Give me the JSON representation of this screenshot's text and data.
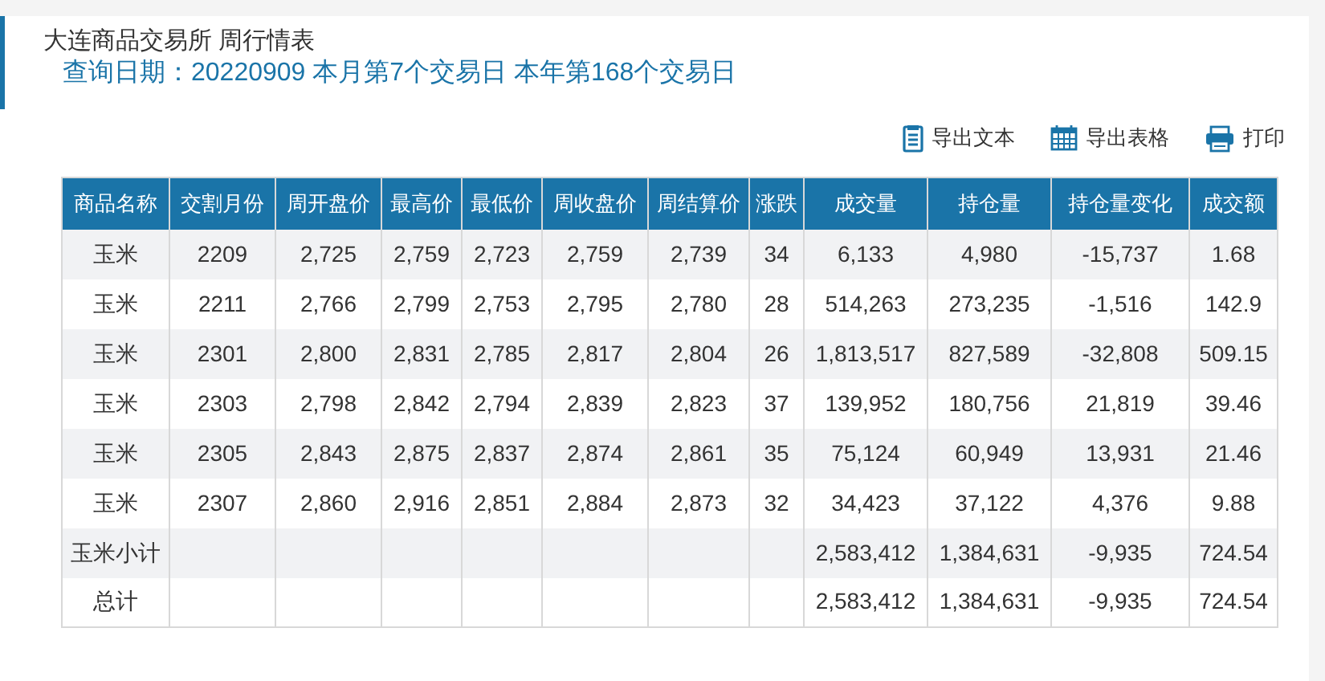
{
  "header": {
    "title": "大连商品交易所 周行情表",
    "query_line": "查询日期：20220909 本月第7个交易日 本年第168个交易日"
  },
  "toolbar": [
    {
      "kind": "text",
      "label": "导出文本"
    },
    {
      "kind": "sheet",
      "label": "导出表格"
    },
    {
      "kind": "print",
      "label": "打印"
    }
  ],
  "table": {
    "columns": [
      "商品名称",
      "交割月份",
      "周开盘价",
      "最高价",
      "最低价",
      "周收盘价",
      "周结算价",
      "涨跌",
      "成交量",
      "持仓量",
      "持仓量变化",
      "成交额"
    ],
    "rows": [
      [
        "玉米",
        "2209",
        "2,725",
        "2,759",
        "2,723",
        "2,759",
        "2,739",
        "34",
        "6,133",
        "4,980",
        "-15,737",
        "1.68"
      ],
      [
        "玉米",
        "2211",
        "2,766",
        "2,799",
        "2,753",
        "2,795",
        "2,780",
        "28",
        "514,263",
        "273,235",
        "-1,516",
        "142.9"
      ],
      [
        "玉米",
        "2301",
        "2,800",
        "2,831",
        "2,785",
        "2,817",
        "2,804",
        "26",
        "1,813,517",
        "827,589",
        "-32,808",
        "509.15"
      ],
      [
        "玉米",
        "2303",
        "2,798",
        "2,842",
        "2,794",
        "2,839",
        "2,823",
        "37",
        "139,952",
        "180,756",
        "21,819",
        "39.46"
      ],
      [
        "玉米",
        "2305",
        "2,843",
        "2,875",
        "2,837",
        "2,874",
        "2,861",
        "35",
        "75,124",
        "60,949",
        "13,931",
        "21.46"
      ],
      [
        "玉米",
        "2307",
        "2,860",
        "2,916",
        "2,851",
        "2,884",
        "2,873",
        "32",
        "34,423",
        "37,122",
        "4,376",
        "9.88"
      ],
      [
        "玉米小计",
        null,
        null,
        null,
        null,
        null,
        null,
        null,
        "2,583,412",
        "1,384,631",
        "-9,935",
        "724.54"
      ],
      [
        "总计",
        null,
        null,
        null,
        null,
        null,
        null,
        null,
        "2,583,412",
        "1,384,631",
        "-9,935",
        "724.54"
      ]
    ]
  }
}
